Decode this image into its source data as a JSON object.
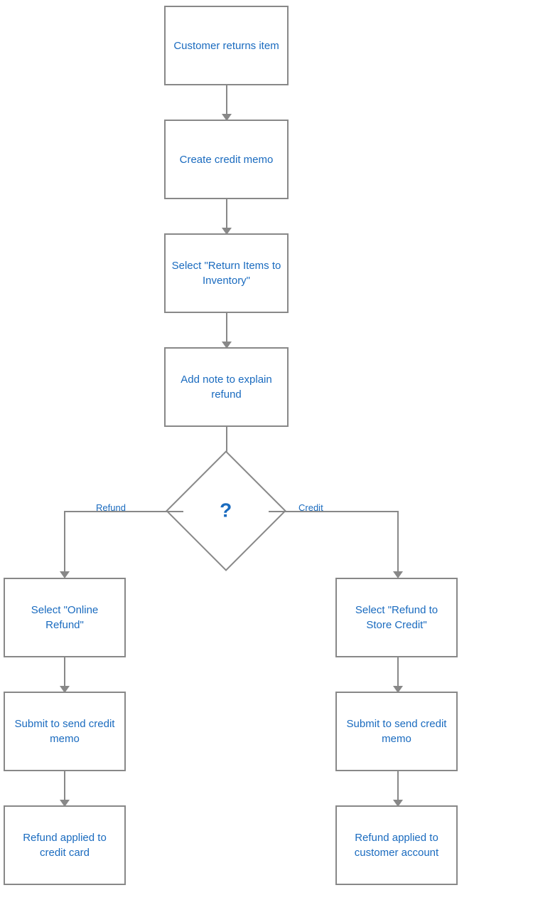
{
  "nodes": {
    "customer_returns": "Customer returns item",
    "create_memo": "Create credit memo",
    "select_return": "Select \"Return Items to Inventory\"",
    "add_note": "Add note to explain refund",
    "diamond": "?",
    "select_online_refund": "Select \"Online Refund\"",
    "select_store_credit": "Select \"Refund to Store Credit\"",
    "submit_left": "Submit to send credit memo",
    "submit_right": "Submit to send credit memo",
    "result_left": "Refund applied to credit card",
    "result_right": "Refund applied to customer account"
  },
  "labels": {
    "refund": "Refund",
    "credit": "Credit"
  }
}
